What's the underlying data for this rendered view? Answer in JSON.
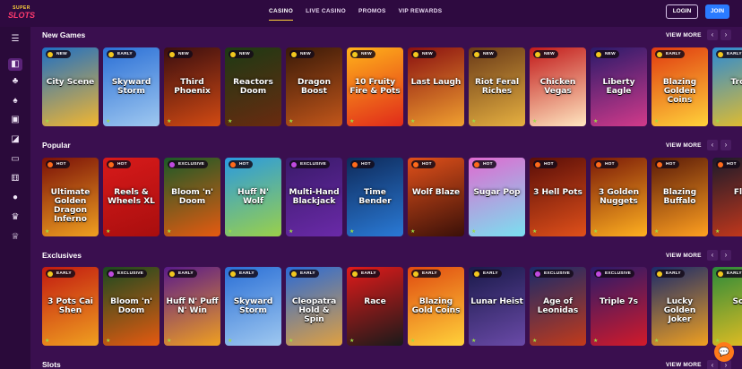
{
  "logo": {
    "line1": "SUPER",
    "line2": "SLOTS"
  },
  "nav": [
    "CASINO",
    "LIVE CASINO",
    "PROMOS",
    "VIP REWARDS"
  ],
  "auth": {
    "login": "LOGIN",
    "join": "JOIN"
  },
  "sidebar_icons": [
    "menu-icon",
    "casino-chips-icon",
    "cherries-icon",
    "spade-icon",
    "slot-machine-icon",
    "live-dealer-icon",
    "laptop-icon",
    "dice-icon",
    "basketball-icon",
    "trophy-icon",
    "crown-icon"
  ],
  "view_more": "VIEW MORE",
  "sections": [
    {
      "title": "New Games",
      "games": [
        {
          "badge": "NEW",
          "name": "City Scene",
          "bg": [
            "#1e6fc4",
            "#f2b630"
          ]
        },
        {
          "badge": "EARLY",
          "name": "Skyward Storm",
          "bg": [
            "#2a6fd6",
            "#9fc8f0"
          ]
        },
        {
          "badge": "NEW",
          "name": "Third Phoenix",
          "bg": [
            "#3a0e10",
            "#d24a12"
          ]
        },
        {
          "badge": "NEW",
          "name": "Reactors Doom",
          "bg": [
            "#1c3a14",
            "#6a2a10"
          ]
        },
        {
          "badge": "NEW",
          "name": "Dragon Boost",
          "bg": [
            "#3a1a08",
            "#c2561a"
          ]
        },
        {
          "badge": "NEW",
          "name": "10 Fruity Fire & Pots",
          "bg": [
            "#ffb21a",
            "#e02a1a"
          ]
        },
        {
          "badge": "NEW",
          "name": "Last Laugh",
          "bg": [
            "#8a1010",
            "#f0a030"
          ]
        },
        {
          "badge": "NEW",
          "name": "Riot Feral Riches",
          "bg": [
            "#6a3a18",
            "#e6b040"
          ]
        },
        {
          "badge": "NEW",
          "name": "Chicken Vegas",
          "bg": [
            "#c21a1a",
            "#ffe6c0"
          ]
        },
        {
          "badge": "NEW",
          "name": "Liberty Eagle",
          "bg": [
            "#2a1a6a",
            "#d23a8a"
          ]
        },
        {
          "badge": "EARLY",
          "name": "Blazing Golden Coins",
          "bg": [
            "#e03a10",
            "#ffd23a"
          ]
        },
        {
          "badge": "EARLY",
          "name": "Troll",
          "bg": [
            "#2a8ad6",
            "#f0c020"
          ]
        }
      ]
    },
    {
      "title": "Popular",
      "games": [
        {
          "badge": "HOT",
          "name": "Ultimate Golden Dragon Inferno",
          "bg": [
            "#7a1008",
            "#f0a020"
          ]
        },
        {
          "badge": "HOT",
          "name": "Reels & Wheels XL",
          "bg": [
            "#d81a1a",
            "#a80e0e"
          ]
        },
        {
          "badge": "EXCLUSIVE",
          "name": "Bloom 'n' Doom",
          "bg": [
            "#1a5a28",
            "#e65a10"
          ]
        },
        {
          "badge": "HOT",
          "name": "Huff N' Wolf",
          "bg": [
            "#2a9ae0",
            "#9ad04a"
          ]
        },
        {
          "badge": "EXCLUSIVE",
          "name": "Multi-Hand Blackjack",
          "bg": [
            "#3a1a6a",
            "#6a2aa8"
          ]
        },
        {
          "badge": "HOT",
          "name": "Time Bender",
          "bg": [
            "#0e2a5a",
            "#2a7ad6"
          ]
        },
        {
          "badge": "HOT",
          "name": "Wolf Blaze",
          "bg": [
            "#e0501a",
            "#3a1008"
          ]
        },
        {
          "badge": "HOT",
          "name": "Sugar Pop",
          "bg": [
            "#e06ad0",
            "#7ae0f0"
          ]
        },
        {
          "badge": "HOT",
          "name": "3 Hell Pots",
          "bg": [
            "#5a0e08",
            "#e0501a"
          ]
        },
        {
          "badge": "HOT",
          "name": "3 Golden Nuggets",
          "bg": [
            "#7a1a08",
            "#ffb020"
          ]
        },
        {
          "badge": "HOT",
          "name": "Blazing Buffalo",
          "bg": [
            "#5a1a08",
            "#ffa020"
          ]
        },
        {
          "badge": "HOT",
          "name": "Fla",
          "bg": [
            "#1a1a2a",
            "#d23a1a"
          ]
        }
      ]
    },
    {
      "title": "Exclusives",
      "games": [
        {
          "badge": "EARLY",
          "name": "3 Pots Cai Shen",
          "bg": [
            "#c21a10",
            "#f0a020"
          ]
        },
        {
          "badge": "EXCLUSIVE",
          "name": "Bloom 'n' Doom",
          "bg": [
            "#1a4a20",
            "#e65a10"
          ]
        },
        {
          "badge": "EARLY",
          "name": "Huff N' Puff N' Win",
          "bg": [
            "#5a1a8a",
            "#f0a020"
          ]
        },
        {
          "badge": "EARLY",
          "name": "Skyward Storm",
          "bg": [
            "#2a6fd6",
            "#9fc8f0"
          ]
        },
        {
          "badge": "EARLY",
          "name": "Cleopatra Hold & Spin",
          "bg": [
            "#2a6ad6",
            "#e0a040"
          ]
        },
        {
          "badge": "EARLY",
          "name": "Race",
          "bg": [
            "#e01a1a",
            "#1a1a1a"
          ]
        },
        {
          "badge": "EARLY",
          "name": "Blazing Gold Coins",
          "bg": [
            "#e04a10",
            "#ffd23a"
          ]
        },
        {
          "badge": "EARLY",
          "name": "Lunar Heist",
          "bg": [
            "#1a1a4a",
            "#6a4aa8"
          ]
        },
        {
          "badge": "EXCLUSIVE",
          "name": "Age of Leonidas",
          "bg": [
            "#1a2a6a",
            "#c23a1a"
          ]
        },
        {
          "badge": "EXCLUSIVE",
          "name": "Triple 7s",
          "bg": [
            "#2a1a6a",
            "#d21a2a"
          ]
        },
        {
          "badge": "EARLY",
          "name": "Lucky Golden Joker",
          "bg": [
            "#1a2a6a",
            "#f0a020"
          ]
        },
        {
          "badge": "EARLY",
          "name": "Soc",
          "bg": [
            "#2a8a3a",
            "#f0c020"
          ]
        }
      ]
    },
    {
      "title": "Slots",
      "games": []
    }
  ],
  "colors": {
    "accent": "#ffd23a",
    "join": "#2a7bff",
    "chat": "#ff7a1a",
    "bg": "#3a0f4f"
  }
}
